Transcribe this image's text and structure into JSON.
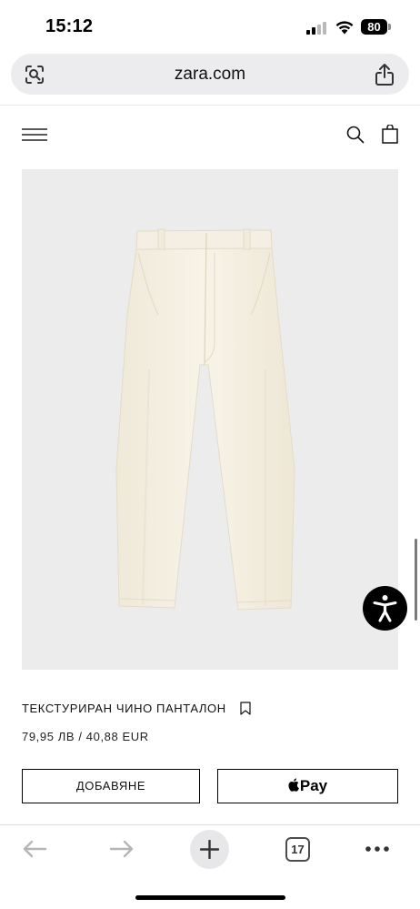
{
  "status_bar": {
    "time": "15:12",
    "battery_level": "80",
    "signal_bars": 2,
    "signal_bars_total": 4
  },
  "browser": {
    "url": "zara.com",
    "open_tabs_count": "17"
  },
  "icons": {
    "lens": "lens-icon",
    "share": "share-icon",
    "menu": "hamburger-menu-icon",
    "search": "search-icon",
    "bag": "shopping-bag-icon",
    "accessibility": "accessibility-icon",
    "bookmark": "bookmark-icon",
    "apple": "apple-logo-icon",
    "back": "back-arrow-icon",
    "forward": "forward-arrow-icon",
    "new_tab": "plus-icon",
    "more": "more-icon"
  },
  "product": {
    "title": "ТЕКСТУРИРАН ЧИНО ПАНТАЛОН",
    "price": "79,95 ЛВ / 40,88 EUR",
    "add_button_label": "ДОБАВЯНЕ",
    "apple_pay_label": "Pay"
  },
  "colors": {
    "image_background": "#ececec",
    "trouser_color": "#f5f1e4",
    "accent": "#000000"
  }
}
